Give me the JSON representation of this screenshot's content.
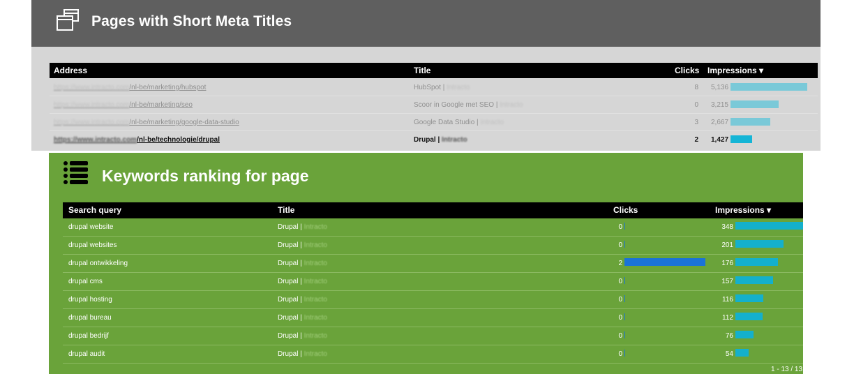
{
  "colors": {
    "panel1_header": "#5f5f5f",
    "panel1_body": "#d6d6d6",
    "panel2_body": "#6aa33a",
    "impressions_bar": "#14b0cc",
    "clicks_bar": "#1a73d9"
  },
  "panel1": {
    "icon": "browser-windows-icon",
    "title": "Pages with Short Meta Titles",
    "headers": {
      "address": "Address",
      "title": "Title",
      "clicks": "Clicks",
      "impressions": "Impressions ▾"
    },
    "rows": [
      {
        "domain": "https://www.intracto.com",
        "path": "/nl-be/marketing/hubspot",
        "title": "HubSpot | ",
        "brand": "Intracto",
        "clicks": "8",
        "impressions": "5,136",
        "share": 1.0
      },
      {
        "domain": "https://www.intracto.com",
        "path": "/nl-be/marketing/seo",
        "title": "Scoor in Google met SEO | ",
        "brand": "Intracto",
        "clicks": "0",
        "impressions": "3,215",
        "share": 0.626
      },
      {
        "domain": "https://www.intracto.com",
        "path": "/nl-be/marketing/google-data-studio",
        "title": "Google Data Studio | ",
        "brand": "Intracto",
        "clicks": "3",
        "impressions": "2,667",
        "share": 0.519
      },
      {
        "domain": "https://www.intracto.com",
        "path": "/nl-be/technologie/drupal",
        "title": "Drupal | ",
        "brand": "Intracto",
        "clicks": "2",
        "impressions": "1,427",
        "share": 0.278
      }
    ]
  },
  "panel2": {
    "icon": "list-icon",
    "title": "Keywords ranking for page",
    "headers": {
      "query": "Search query",
      "title": "Title",
      "clicks": "Clicks",
      "impressions": "Impressions ▾"
    },
    "rows": [
      {
        "query": "drupal website",
        "title": "Drupal | ",
        "brand": "Intracto",
        "clicks": "0",
        "impressions": "348",
        "click_share": 0,
        "imp_share": 1.0
      },
      {
        "query": "drupal websites",
        "title": "Drupal | ",
        "brand": "Intracto",
        "clicks": "0",
        "impressions": "201",
        "click_share": 0,
        "imp_share": 0.578
      },
      {
        "query": "drupal ontwikkeling",
        "title": "Drupal | ",
        "brand": "Intracto",
        "clicks": "2",
        "impressions": "176",
        "click_share": 1.0,
        "imp_share": 0.506
      },
      {
        "query": "drupal cms",
        "title": "Drupal | ",
        "brand": "Intracto",
        "clicks": "0",
        "impressions": "157",
        "click_share": 0,
        "imp_share": 0.451
      },
      {
        "query": "drupal hosting",
        "title": "Drupal | ",
        "brand": "Intracto",
        "clicks": "0",
        "impressions": "116",
        "click_share": 0,
        "imp_share": 0.333
      },
      {
        "query": "drupal bureau",
        "title": "Drupal | ",
        "brand": "Intracto",
        "clicks": "0",
        "impressions": "112",
        "click_share": 0,
        "imp_share": 0.322
      },
      {
        "query": "drupal bedrijf",
        "title": "Drupal | ",
        "brand": "Intracto",
        "clicks": "0",
        "impressions": "76",
        "click_share": 0,
        "imp_share": 0.218
      },
      {
        "query": "drupal audit",
        "title": "Drupal | ",
        "brand": "Intracto",
        "clicks": "0",
        "impressions": "54",
        "click_share": 0,
        "imp_share": 0.155
      }
    ],
    "pager": "1 - 13 / 13"
  }
}
